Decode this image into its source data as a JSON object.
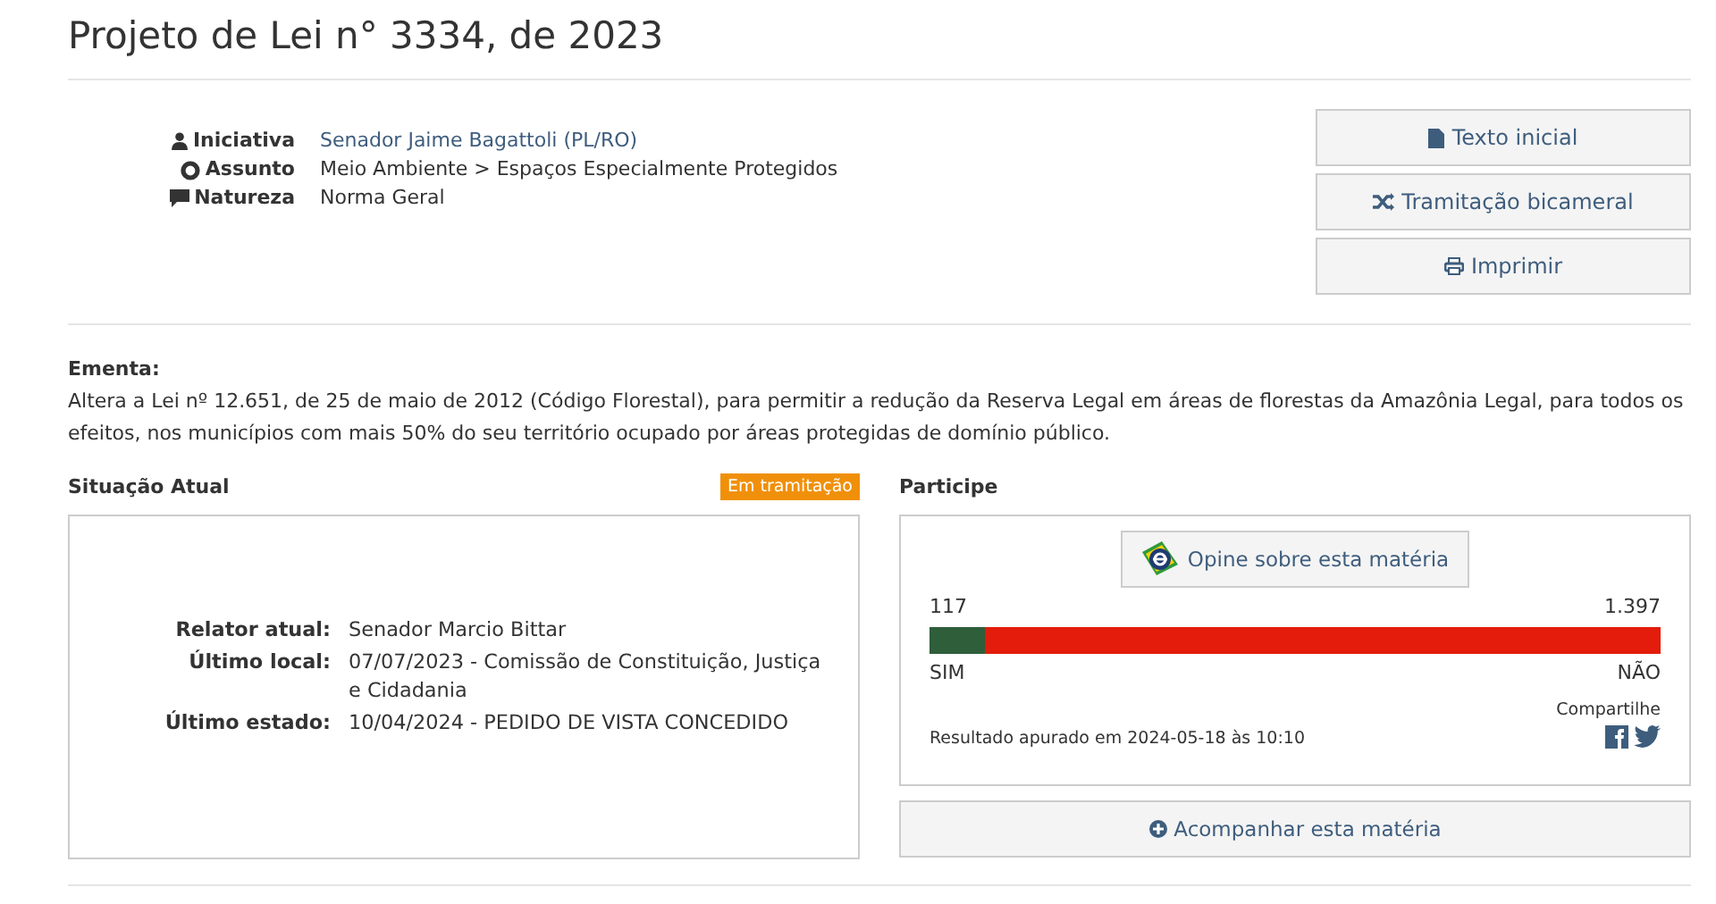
{
  "title": "Projeto de Lei n° 3334, de 2023",
  "meta": [
    {
      "label": "Iniciativa",
      "value": "Senador Jaime Bagattoli (PL/RO)",
      "link": true
    },
    {
      "label": "Assunto",
      "value": "Meio Ambiente > Espaços Especialmente Protegidos",
      "link": false
    },
    {
      "label": "Natureza",
      "value": "Norma Geral",
      "link": false
    }
  ],
  "actions": [
    "Texto inicial",
    "Tramitação bicameral",
    "Imprimir"
  ],
  "ementa": {
    "label": "Ementa:",
    "text": "Altera a Lei nº 12.651, de 25 de maio de 2012 (Código Florestal), para permitir a redução da Reserva Legal em áreas de florestas da Amazônia Legal, para todos os efeitos, nos municípios com mais 50% do seu território ocupado por áreas protegidas de domínio público."
  },
  "situacao": {
    "heading": "Situação Atual",
    "badge": "Em tramitação",
    "rows": [
      {
        "label": "Relator atual:",
        "value": "Senador Marcio Bittar"
      },
      {
        "label": "Último local:",
        "value": "07/07/2023 - Comissão de Constituição, Justiça e Cidadania"
      },
      {
        "label": "Último estado:",
        "value": "10/04/2024 - PEDIDO DE VISTA CONCEDIDO"
      }
    ]
  },
  "participe": {
    "heading": "Participe",
    "button": "Opine sobre esta matéria",
    "yes_count": "117",
    "no_count": "1.397",
    "level": 0.077,
    "yes_label": "SIM",
    "no_label": "NÃO",
    "result": "Resultado apurado em 2024-05-18 às 10:10",
    "share": "Compartilhe",
    "follow": "Acompanhar esta matéria"
  }
}
